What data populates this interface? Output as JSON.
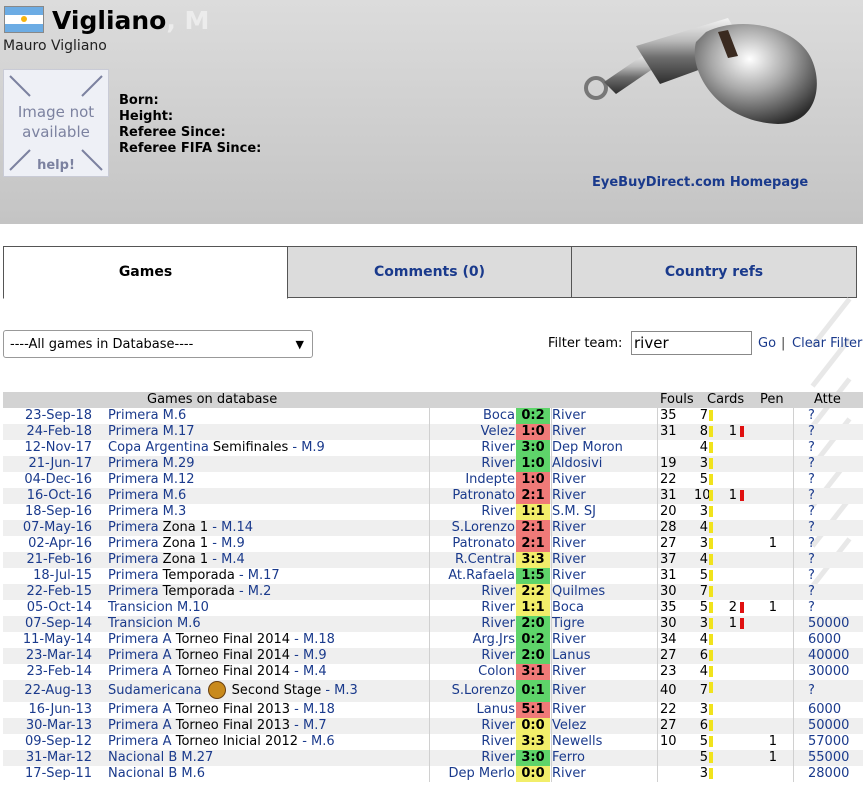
{
  "referee": {
    "surname": "Vigliano",
    "initial": ", M",
    "full_name": "Mauro Vigliano",
    "photo_text": "Image not available",
    "photo_help": "help!",
    "fields": [
      "Born:",
      "Height:",
      "Referee Since:",
      "Referee FIFA Since:"
    ]
  },
  "ad": {
    "link_text": "EyeBuyDirect.com Homepage"
  },
  "tabs": [
    {
      "label": "Games",
      "active": true
    },
    {
      "label": "Comments (0)",
      "active": false
    },
    {
      "label": "Country refs",
      "active": false
    }
  ],
  "filter": {
    "select_value": "----All games in Database----",
    "label": "Filter team:",
    "value": "river",
    "go": "Go",
    "separator": "|",
    "clear": "Clear Filter"
  },
  "table": {
    "headers": {
      "games": "Games on database",
      "fouls": "Fouls",
      "cards": "Cards",
      "pen": "Pen",
      "att": "Atte"
    },
    "score_colors": {
      "green": "#5ed46a",
      "red": "#f07a78",
      "yellow": "#f2ee6a"
    },
    "rows": [
      {
        "date": "23-Sep-18",
        "comp": [
          [
            "Primera M.6",
            "link"
          ]
        ],
        "home": "Boca",
        "score": "0:2",
        "color": "green",
        "away": "River",
        "fouls": "35",
        "yellow": "7",
        "red": "",
        "pen": "",
        "att": "?"
      },
      {
        "date": "24-Feb-18",
        "comp": [
          [
            "Primera M.17",
            "link"
          ]
        ],
        "home": "Velez",
        "score": "1:0",
        "color": "red",
        "away": "River",
        "fouls": "31",
        "yellow": "8",
        "red": "1",
        "pen": "",
        "att": "?"
      },
      {
        "date": "12-Nov-17",
        "comp": [
          [
            "Copa Argentina",
            "link"
          ],
          [
            " Semifinales",
            "text"
          ],
          [
            " - M.9",
            "link"
          ]
        ],
        "home": "River",
        "score": "3:0",
        "color": "green",
        "away": "Dep Moron",
        "fouls": "",
        "yellow": "4",
        "red": "",
        "pen": "",
        "att": "?"
      },
      {
        "date": "21-Jun-17",
        "comp": [
          [
            "Primera M.29",
            "link"
          ]
        ],
        "home": "River",
        "score": "1:0",
        "color": "green",
        "away": "Aldosivi",
        "fouls": "19",
        "yellow": "3",
        "red": "",
        "pen": "",
        "att": "?"
      },
      {
        "date": "04-Dec-16",
        "comp": [
          [
            "Primera M.12",
            "link"
          ]
        ],
        "home": "Indepte",
        "score": "1:0",
        "color": "red",
        "away": "River",
        "fouls": "22",
        "yellow": "5",
        "red": "",
        "pen": "",
        "att": "?"
      },
      {
        "date": "16-Oct-16",
        "comp": [
          [
            "Primera M.6",
            "link"
          ]
        ],
        "home": "Patronato",
        "score": "2:1",
        "color": "red",
        "away": "River",
        "fouls": "31",
        "yellow": "10",
        "red": "1",
        "pen": "",
        "att": "?"
      },
      {
        "date": "18-Sep-16",
        "comp": [
          [
            "Primera M.3",
            "link"
          ]
        ],
        "home": "River",
        "score": "1:1",
        "color": "yellow",
        "away": "S.M. SJ",
        "fouls": "20",
        "yellow": "3",
        "red": "",
        "pen": "",
        "att": "?"
      },
      {
        "date": "07-May-16",
        "comp": [
          [
            "Primera",
            "link"
          ],
          [
            " Zona 1",
            "text"
          ],
          [
            " - M.14",
            "link"
          ]
        ],
        "home": "S.Lorenzo",
        "score": "2:1",
        "color": "red",
        "away": "River",
        "fouls": "28",
        "yellow": "4",
        "red": "",
        "pen": "",
        "att": "?"
      },
      {
        "date": "02-Apr-16",
        "comp": [
          [
            "Primera",
            "link"
          ],
          [
            " Zona 1",
            "text"
          ],
          [
            " - M.9",
            "link"
          ]
        ],
        "home": "Patronato",
        "score": "2:1",
        "color": "red",
        "away": "River",
        "fouls": "27",
        "yellow": "3",
        "red": "",
        "pen": "1",
        "att": "?"
      },
      {
        "date": "21-Feb-16",
        "comp": [
          [
            "Primera",
            "link"
          ],
          [
            " Zona 1",
            "text"
          ],
          [
            " - M.4",
            "link"
          ]
        ],
        "home": "R.Central",
        "score": "3:3",
        "color": "yellow",
        "away": "River",
        "fouls": "37",
        "yellow": "4",
        "red": "",
        "pen": "",
        "att": "?"
      },
      {
        "date": "18-Jul-15",
        "comp": [
          [
            "Primera",
            "link"
          ],
          [
            " Temporada",
            "text"
          ],
          [
            " - M.17",
            "link"
          ]
        ],
        "home": "At.Rafaela",
        "score": "1:5",
        "color": "green",
        "away": "River",
        "fouls": "31",
        "yellow": "5",
        "red": "",
        "pen": "",
        "att": "?"
      },
      {
        "date": "22-Feb-15",
        "comp": [
          [
            "Primera",
            "link"
          ],
          [
            " Temporada",
            "text"
          ],
          [
            " - M.2",
            "link"
          ]
        ],
        "home": "River",
        "score": "2:2",
        "color": "yellow",
        "away": "Quilmes",
        "fouls": "30",
        "yellow": "7",
        "red": "",
        "pen": "",
        "att": "?"
      },
      {
        "date": "05-Oct-14",
        "comp": [
          [
            "Transicion M.10",
            "link"
          ]
        ],
        "home": "River",
        "score": "1:1",
        "color": "yellow",
        "away": "Boca",
        "fouls": "35",
        "yellow": "5",
        "red": "2",
        "pen": "1",
        "att": "?"
      },
      {
        "date": "07-Sep-14",
        "comp": [
          [
            "Transicion M.6",
            "link"
          ]
        ],
        "home": "River",
        "score": "2:0",
        "color": "green",
        "away": "Tigre",
        "fouls": "30",
        "yellow": "3",
        "red": "1",
        "pen": "",
        "att": "50000"
      },
      {
        "date": "11-May-14",
        "comp": [
          [
            "Primera A",
            "link"
          ],
          [
            " Torneo Final 2014",
            "text"
          ],
          [
            " - M.18",
            "link"
          ]
        ],
        "home": "Arg.Jrs",
        "score": "0:2",
        "color": "green",
        "away": "River",
        "fouls": "34",
        "yellow": "4",
        "red": "",
        "pen": "",
        "att": "6000"
      },
      {
        "date": "23-Mar-14",
        "comp": [
          [
            "Primera A",
            "link"
          ],
          [
            " Torneo Final 2014",
            "text"
          ],
          [
            " - M.9",
            "link"
          ]
        ],
        "home": "River",
        "score": "2:0",
        "color": "green",
        "away": "Lanus",
        "fouls": "27",
        "yellow": "6",
        "red": "",
        "pen": "",
        "att": "40000"
      },
      {
        "date": "23-Feb-14",
        "comp": [
          [
            "Primera A",
            "link"
          ],
          [
            " Torneo Final 2014",
            "text"
          ],
          [
            " - M.4",
            "link"
          ]
        ],
        "home": "Colon",
        "score": "3:1",
        "color": "red",
        "away": "River",
        "fouls": "23",
        "yellow": "4",
        "red": "",
        "pen": "",
        "att": "30000"
      },
      {
        "date": "22-Aug-13",
        "comp": [
          [
            "Sudamericana",
            "link"
          ],
          [
            "LOGO",
            "logo"
          ],
          [
            "Second Stage",
            "text"
          ],
          [
            " - M.3",
            "link"
          ]
        ],
        "home": "S.Lorenzo",
        "score": "0:1",
        "color": "green",
        "away": "River",
        "fouls": "40",
        "yellow": "7",
        "red": "",
        "pen": "",
        "att": "?",
        "tall": true
      },
      {
        "date": "16-Jun-13",
        "comp": [
          [
            "Primera A",
            "link"
          ],
          [
            " Torneo Final 2013",
            "text"
          ],
          [
            " - M.18",
            "link"
          ]
        ],
        "home": "Lanus",
        "score": "5:1",
        "color": "red",
        "away": "River",
        "fouls": "22",
        "yellow": "3",
        "red": "",
        "pen": "",
        "att": "6000"
      },
      {
        "date": "30-Mar-13",
        "comp": [
          [
            "Primera A",
            "link"
          ],
          [
            " Torneo Final 2013",
            "text"
          ],
          [
            " - M.7",
            "link"
          ]
        ],
        "home": "River",
        "score": "0:0",
        "color": "yellow",
        "away": "Velez",
        "fouls": "27",
        "yellow": "6",
        "red": "",
        "pen": "",
        "att": "50000"
      },
      {
        "date": "09-Sep-12",
        "comp": [
          [
            "Primera A",
            "link"
          ],
          [
            " Torneo Inicial 2012",
            "text"
          ],
          [
            " - M.6",
            "link"
          ]
        ],
        "home": "River",
        "score": "3:3",
        "color": "yellow",
        "away": "Newells",
        "fouls": "10",
        "yellow": "5",
        "red": "",
        "pen": "1",
        "att": "57000"
      },
      {
        "date": "31-Mar-12",
        "comp": [
          [
            "Nacional B",
            "link"
          ],
          [
            " M.27",
            "link"
          ]
        ],
        "home": "River",
        "score": "3:0",
        "color": "green",
        "away": "Ferro",
        "fouls": "",
        "yellow": "5",
        "red": "",
        "pen": "1",
        "att": "55000"
      },
      {
        "date": "17-Sep-11",
        "comp": [
          [
            "Nacional B",
            "link"
          ],
          [
            " M.6",
            "link"
          ]
        ],
        "home": "Dep Merlo",
        "score": "0:0",
        "color": "yellow",
        "away": "River",
        "fouls": "",
        "yellow": "3",
        "red": "",
        "pen": "",
        "att": "28000"
      }
    ]
  }
}
